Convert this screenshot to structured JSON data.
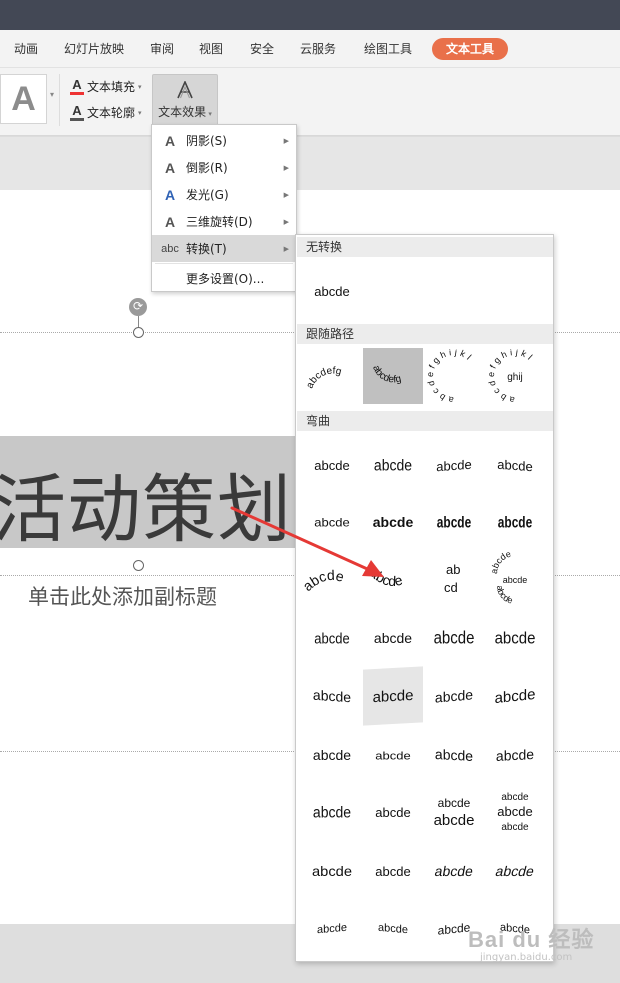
{
  "menubar": {
    "items": [
      "动画",
      "幻灯片放映",
      "审阅",
      "视图",
      "安全",
      "云服务",
      "绘图工具"
    ],
    "active": "文本工具",
    "accent": "#e9704a"
  },
  "ribbon": {
    "big_a": "A",
    "fill_label": "文本填充",
    "outline_label": "文本轮廓",
    "effect_label": "文本效果",
    "icons": [
      "text-fill-icon",
      "text-outline-icon",
      "text-effect-icon"
    ]
  },
  "dropdown": {
    "items": [
      {
        "label": "阴影(S)",
        "icon": "A"
      },
      {
        "label": "倒影(R)",
        "icon": "A"
      },
      {
        "label": "发光(G)",
        "icon": "A"
      },
      {
        "label": "三维旋转(D)",
        "icon": "A"
      },
      {
        "label": "转换(T)",
        "icon": "abc"
      },
      {
        "label": "更多设置(O)..."
      }
    ]
  },
  "gallery": {
    "sections": {
      "none": "无转换",
      "follow_path": "跟随路径",
      "warp": "弯曲"
    },
    "sample": "abcde",
    "circle_text": "abcdefg",
    "circle_text_long": "abcdefghijkl",
    "button_text": "ghij",
    "stack_lines": [
      "abcde",
      "abcde",
      "abcde"
    ],
    "pour_lines": [
      "ab",
      "cd"
    ]
  },
  "slide": {
    "title": "活动策划",
    "subtitle": "单击此处添加副标题"
  },
  "watermark": {
    "main": "Bai du 经验",
    "sub": "jingyan.baidu.com"
  },
  "annotation_color": "#e53935"
}
